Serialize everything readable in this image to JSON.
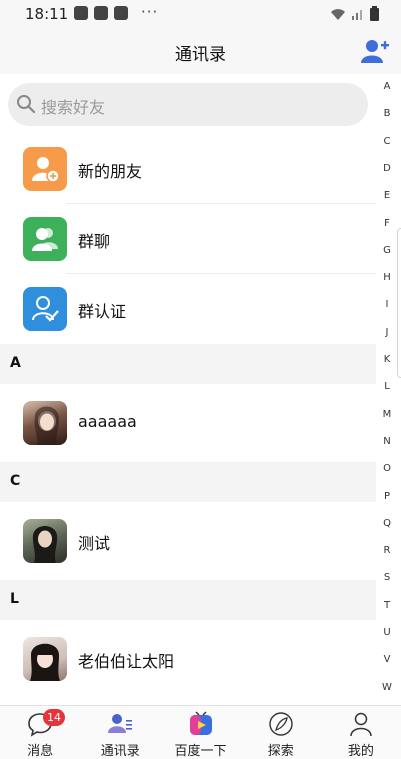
{
  "status_bar": {
    "time": "18:11",
    "more": "···"
  },
  "header": {
    "title": "通讯录"
  },
  "search": {
    "placeholder": "搜索好友"
  },
  "features": [
    {
      "label": "新的朋友",
      "color": "#f79a4a"
    },
    {
      "label": "群聊",
      "color": "#3db15a"
    },
    {
      "label": "群认证",
      "color": "#2f8fdd"
    }
  ],
  "sections": [
    {
      "letter": "A",
      "contacts": [
        {
          "name": "aaaaaa"
        }
      ]
    },
    {
      "letter": "C",
      "contacts": [
        {
          "name": "测试"
        }
      ]
    },
    {
      "letter": "L",
      "contacts": [
        {
          "name": "老伯伯让太阳"
        }
      ]
    }
  ],
  "index_letters": [
    "A",
    "B",
    "C",
    "D",
    "E",
    "F",
    "G",
    "H",
    "I",
    "J",
    "K",
    "L",
    "M",
    "N",
    "O",
    "P",
    "Q",
    "R",
    "S",
    "T",
    "U",
    "V",
    "W"
  ],
  "tabs": [
    {
      "label": "消息",
      "badge": "14",
      "icon": "chat-icon"
    },
    {
      "label": "通讯录",
      "icon": "contacts-icon"
    },
    {
      "label": "百度一下",
      "icon": "baidu-video-icon"
    },
    {
      "label": "探索",
      "icon": "compass-feather-icon"
    },
    {
      "label": "我的",
      "icon": "person-icon"
    }
  ],
  "colors": {
    "accent": "#3e6fd8",
    "badge": "#e8333a"
  }
}
